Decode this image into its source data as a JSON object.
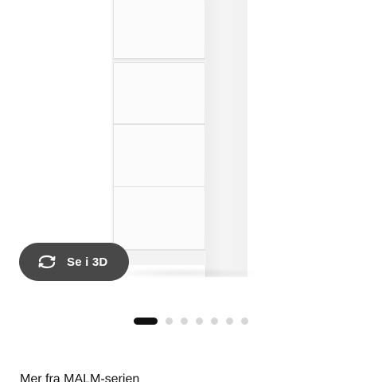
{
  "product_image": {
    "alt": "MALM dresser with 4 drawers",
    "icon": "dresser-image"
  },
  "view_3d": {
    "label": "Se i 3D",
    "icon": "rotate-3d-icon"
  },
  "carousel": {
    "total": 7,
    "active_index": 0
  },
  "section": {
    "heading": "Mer fra MALM-serien"
  },
  "colors": {
    "button_bg": "#484848",
    "dot_active": "#111111",
    "dot_inactive": "#d6d6d6"
  }
}
